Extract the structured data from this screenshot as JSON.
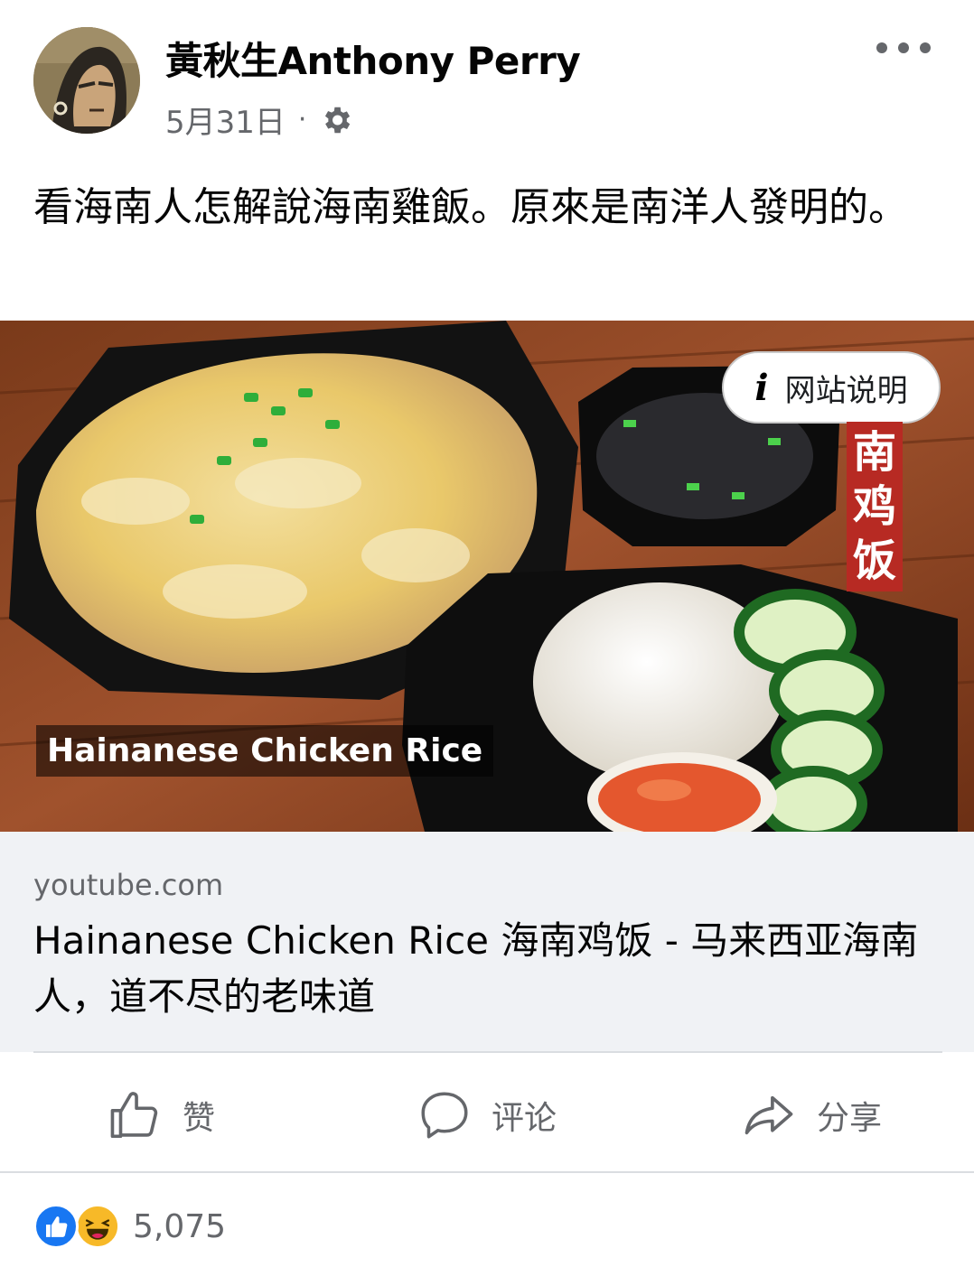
{
  "post": {
    "author": "黃秋生Anthony Perry",
    "date": "5月31日",
    "separator": "·",
    "privacy_icon": "gear-icon",
    "text": "看海南人怎解說海南雞飯。原來是南洋人發明的。"
  },
  "preview": {
    "info_label": "网站说明",
    "banner_chars": [
      "南",
      "鸡",
      "饭"
    ],
    "caption": "Hainanese Chicken Rice"
  },
  "link": {
    "domain": "youtube.com",
    "title": "Hainanese Chicken Rice 海南鸡饭 - 马来西亚海南人，道不尽的老味道"
  },
  "actions": {
    "like": "赞",
    "comment": "评论",
    "share": "分享"
  },
  "reactions": {
    "count": "5,075",
    "types": [
      "like-icon",
      "haha-icon"
    ]
  },
  "colors": {
    "brand": "#1877f2",
    "secondary_text": "#65676b",
    "link_box_bg": "#f0f2f5",
    "banner_red": "#b72a23"
  }
}
